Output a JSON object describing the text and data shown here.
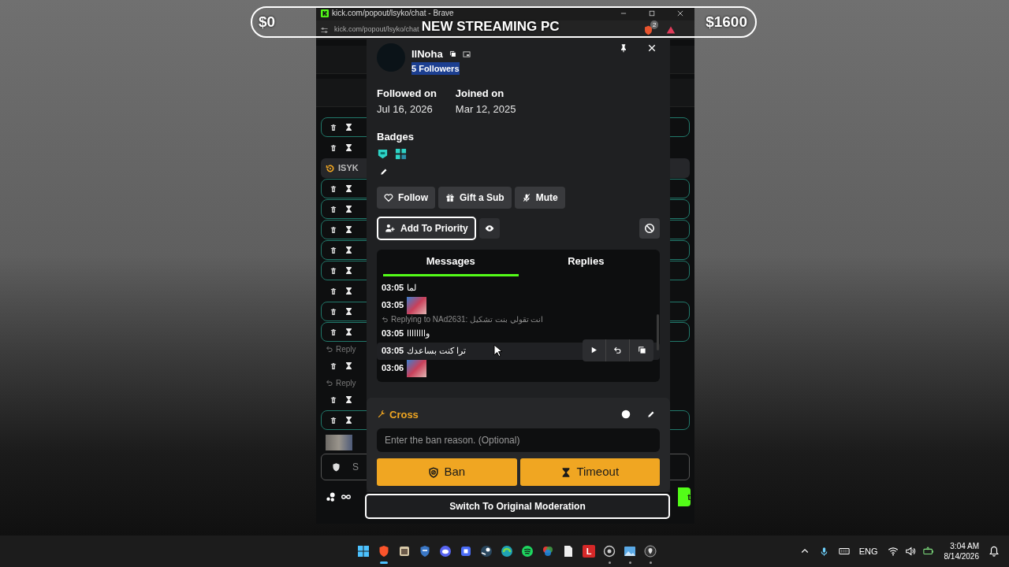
{
  "goal": {
    "start": "$0",
    "title": "NEW STREAMING PC",
    "end": "$1600"
  },
  "browser": {
    "title": "kick.com/popout/lsyko/chat - Brave",
    "url": "kick.com/popout/lsyko/chat",
    "shield_count": "2"
  },
  "chat_rows": [
    {
      "kind": "mod",
      "highlighted": true
    },
    {
      "kind": "mod",
      "highlighted": false
    },
    {
      "kind": "user",
      "label": "ISYK"
    },
    {
      "kind": "mod",
      "highlighted": true
    },
    {
      "kind": "mod",
      "highlighted": true
    },
    {
      "kind": "mod",
      "highlighted": true
    },
    {
      "kind": "mod",
      "highlighted": true
    },
    {
      "kind": "mod",
      "highlighted": true
    },
    {
      "kind": "mod",
      "highlighted": false
    },
    {
      "kind": "mod",
      "highlighted": true
    },
    {
      "kind": "mod",
      "highlighted": true
    },
    {
      "kind": "reply",
      "label": "Reply"
    },
    {
      "kind": "mod",
      "highlighted": false
    },
    {
      "kind": "reply",
      "label": "Reply"
    },
    {
      "kind": "mod",
      "highlighted": false
    },
    {
      "kind": "mod",
      "highlighted": true
    },
    {
      "kind": "thumb"
    },
    {
      "kind": "input",
      "label": "S"
    }
  ],
  "chat_bar": {
    "send_label": "t"
  },
  "user_card": {
    "username": "IlNoha",
    "followers": "5 Followers",
    "followers_selected": true,
    "followed_label": "Followed on",
    "followed_date": "Jul 16, 2026",
    "joined_label": "Joined on",
    "joined_date": "Mar 12, 2025",
    "badges_label": "Badges",
    "actions": [
      {
        "kind": "follow",
        "label": "Follow"
      },
      {
        "kind": "gift",
        "label": "Gift a Sub"
      },
      {
        "kind": "mute",
        "label": "Mute"
      }
    ],
    "priority": {
      "label": "Add To Priority",
      "focused": true
    },
    "tabs": [
      {
        "label": "Messages",
        "selected": true
      },
      {
        "label": "Replies",
        "selected": false
      }
    ],
    "messages": [
      {
        "kind": "text",
        "time": "03:05",
        "text": "لما",
        "hovered": false
      },
      {
        "kind": "emote",
        "time": "03:05",
        "hovered": false
      },
      {
        "kind": "context",
        "text": "Replying to NAd2631: انت تقولي بنت تشكيل"
      },
      {
        "kind": "text",
        "time": "03:05",
        "text": "واااااااا",
        "hovered": false
      },
      {
        "kind": "text",
        "time": "03:05",
        "text": "ترا كنت بساعدك",
        "hovered": true
      },
      {
        "kind": "emote",
        "time": "03:06",
        "hovered": false
      }
    ],
    "moderation": {
      "title": "Cross",
      "reason_placeholder": "Enter the ban reason. (Optional)",
      "ban": "Ban",
      "timeout": "Timeout"
    },
    "switch_button": "Switch To Original Moderation"
  },
  "taskbar": {
    "apps": [
      {
        "kind": "start",
        "active": false,
        "running": false
      },
      {
        "kind": "browser",
        "active": true,
        "running": true
      },
      {
        "kind": "photo",
        "active": false,
        "running": false
      },
      {
        "kind": "shield",
        "active": false,
        "running": false
      },
      {
        "kind": "chat",
        "active": false,
        "running": false
      },
      {
        "kind": "square",
        "active": false,
        "running": false
      },
      {
        "kind": "steam",
        "active": false,
        "running": false
      },
      {
        "kind": "edge",
        "active": false,
        "running": false
      },
      {
        "kind": "music",
        "active": false,
        "running": false
      },
      {
        "kind": "colors",
        "active": false,
        "running": false
      },
      {
        "kind": "file",
        "active": false,
        "running": false
      },
      {
        "kind": "letter",
        "label": "L",
        "active": false,
        "running": false
      },
      {
        "kind": "record",
        "active": false,
        "running": true
      },
      {
        "kind": "image",
        "active": false,
        "running": true
      },
      {
        "kind": "circle",
        "active": false,
        "running": true
      }
    ],
    "language": "ENG",
    "time": "3:04 AM",
    "date": "8/14/2026"
  }
}
